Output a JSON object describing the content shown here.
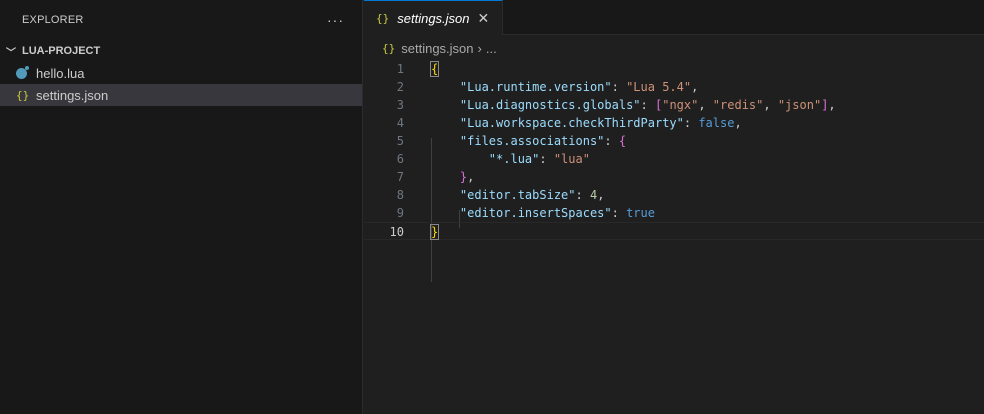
{
  "sidebar": {
    "title": "EXPLORER",
    "more": "···",
    "folder": "LUA-PROJECT",
    "files": [
      {
        "name": "hello.lua",
        "icon": "lua-icon"
      },
      {
        "name": "settings.json",
        "icon": "json-braces-icon"
      }
    ]
  },
  "tab": {
    "label": "settings.json",
    "icon": "{}",
    "close": "✕"
  },
  "breadcrumb": {
    "file": "settings.json",
    "sep": "›",
    "more": "..."
  },
  "code": {
    "current_line": 10,
    "lines": [
      [
        [
          "y",
          "{"
        ]
      ],
      [
        [
          "p",
          "    "
        ],
        [
          "k",
          "\"Lua.runtime.version\""
        ],
        [
          "p",
          ": "
        ],
        [
          "s",
          "\"Lua 5.4\""
        ],
        [
          "p",
          ","
        ]
      ],
      [
        [
          "p",
          "    "
        ],
        [
          "k",
          "\"Lua.diagnostics.globals\""
        ],
        [
          "p",
          ": "
        ],
        [
          "m",
          "["
        ],
        [
          "s",
          "\"ngx\""
        ],
        [
          "p",
          ", "
        ],
        [
          "s",
          "\"redis\""
        ],
        [
          "p",
          ", "
        ],
        [
          "s",
          "\"json\""
        ],
        [
          "m",
          "]"
        ],
        [
          "p",
          ","
        ]
      ],
      [
        [
          "p",
          "    "
        ],
        [
          "k",
          "\"Lua.workspace.checkThirdParty\""
        ],
        [
          "p",
          ": "
        ],
        [
          "b",
          "false"
        ],
        [
          "p",
          ","
        ]
      ],
      [
        [
          "p",
          "    "
        ],
        [
          "k",
          "\"files.associations\""
        ],
        [
          "p",
          ": "
        ],
        [
          "m",
          "{"
        ]
      ],
      [
        [
          "p",
          "        "
        ],
        [
          "k",
          "\"*.lua\""
        ],
        [
          "p",
          ": "
        ],
        [
          "s",
          "\"lua\""
        ]
      ],
      [
        [
          "p",
          "    "
        ],
        [
          "m",
          "}"
        ],
        [
          "p",
          ","
        ]
      ],
      [
        [
          "p",
          "    "
        ],
        [
          "k",
          "\"editor.tabSize\""
        ],
        [
          "p",
          ": "
        ],
        [
          "n",
          "4"
        ],
        [
          "p",
          ","
        ]
      ],
      [
        [
          "p",
          "    "
        ],
        [
          "k",
          "\"editor.insertSpaces\""
        ],
        [
          "p",
          ": "
        ],
        [
          "b",
          "true"
        ]
      ],
      [
        [
          "y",
          "}"
        ]
      ]
    ]
  }
}
